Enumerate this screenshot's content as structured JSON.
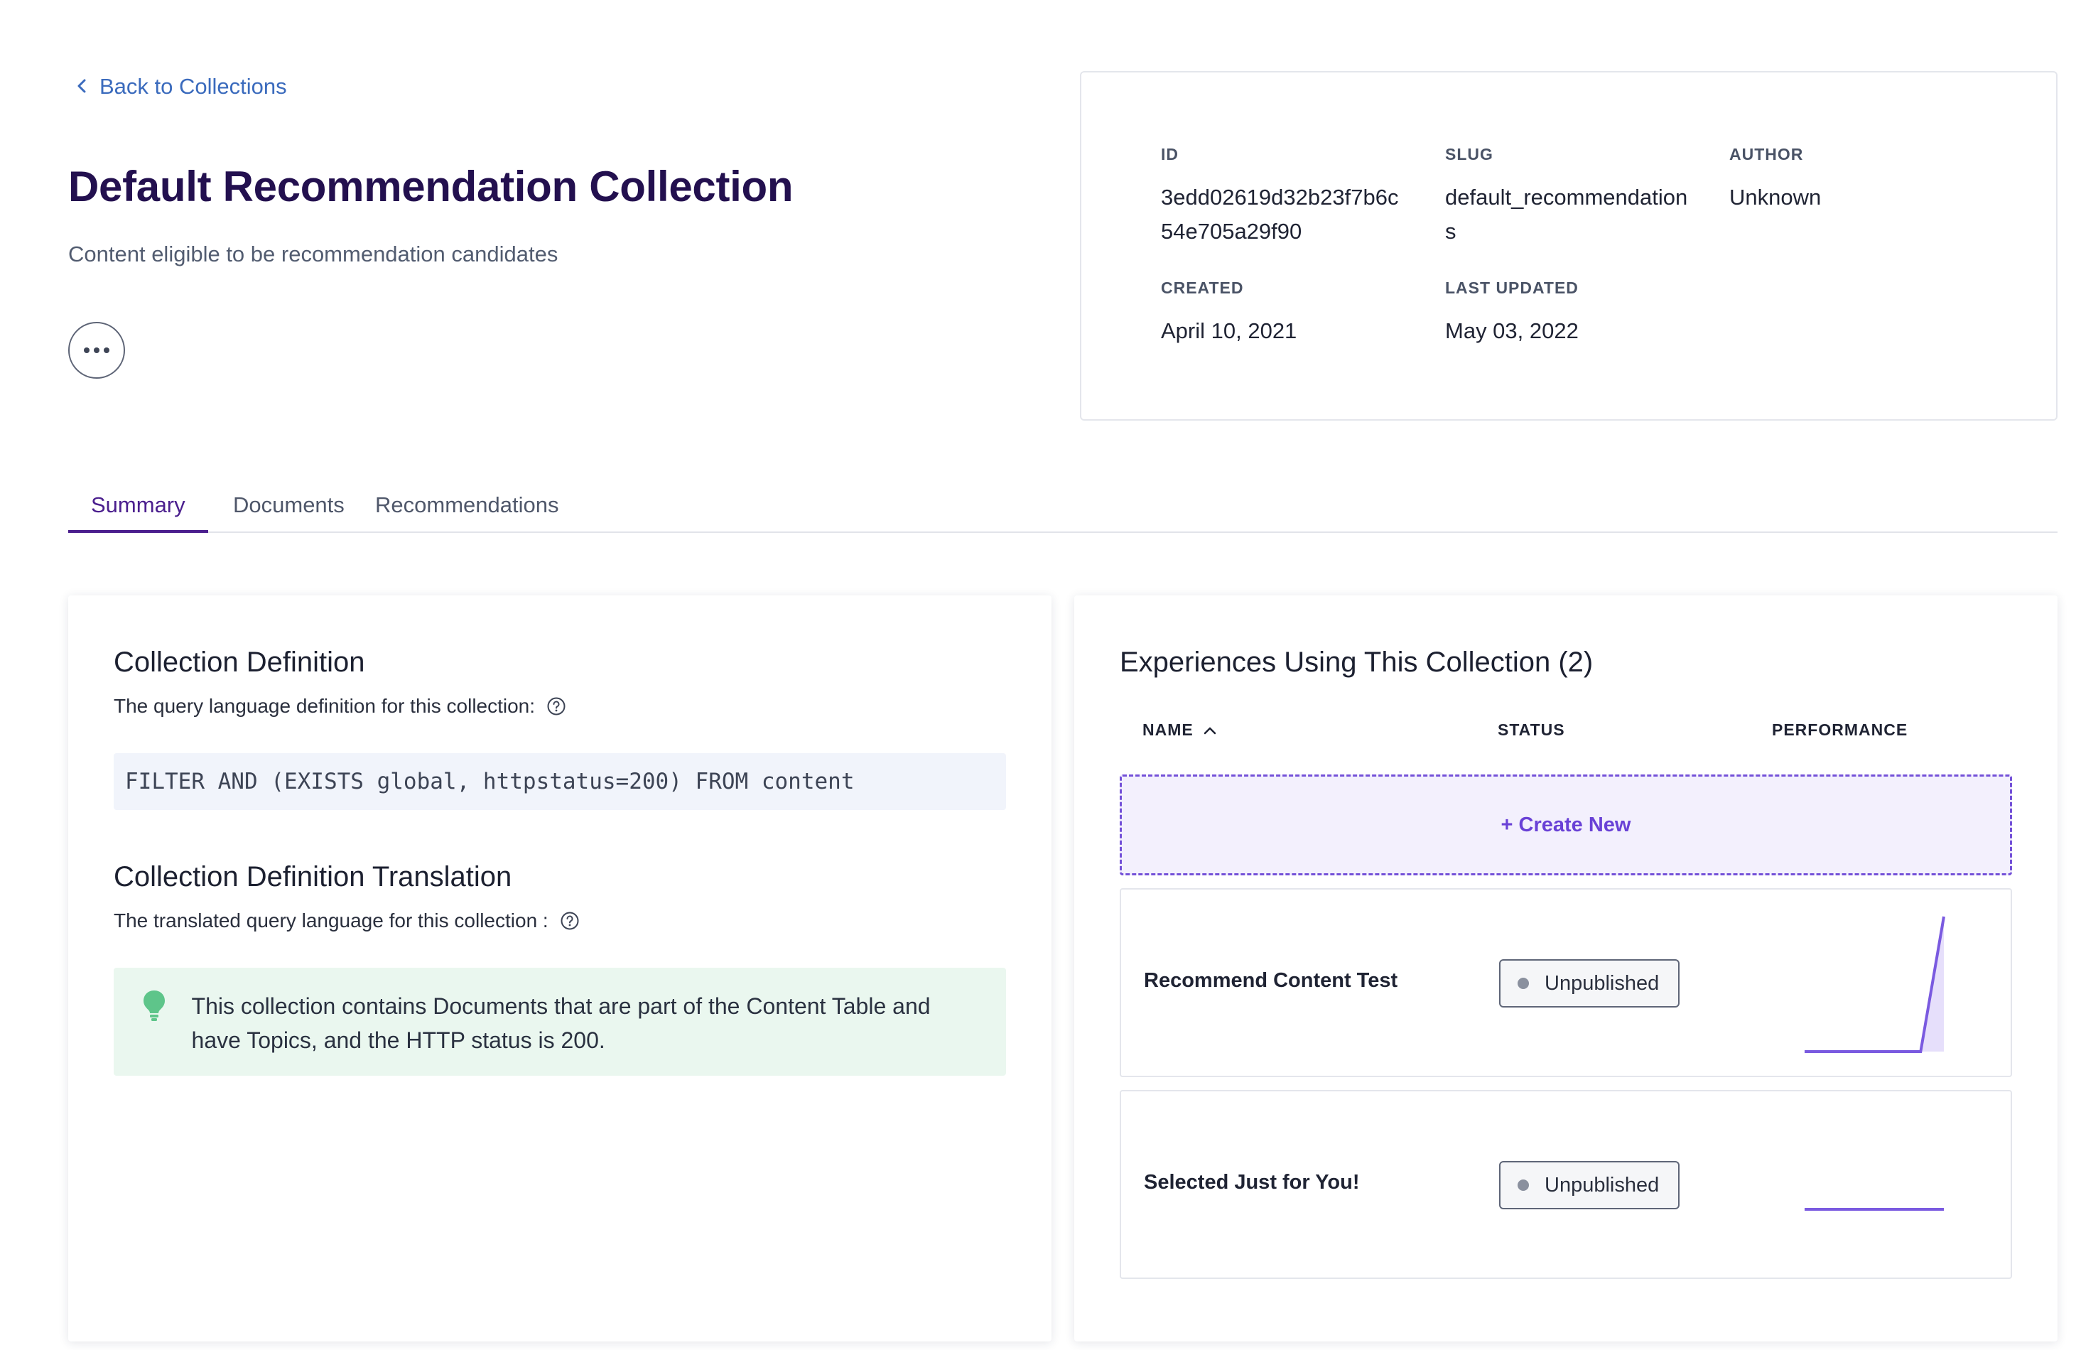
{
  "header": {
    "back_link": "Back to Collections",
    "title": "Default Recommendation Collection",
    "subtitle": "Content eligible to be recommendation candidates",
    "more_icon": "ellipsis-icon"
  },
  "meta": {
    "id_label": "ID",
    "id_value": "3edd02619d32b23f7b6c54e705a29f90",
    "slug_label": "SLUG",
    "slug_value": "default_recommendations",
    "author_label": "AUTHOR",
    "author_value": "Unknown",
    "created_label": "CREATED",
    "created_value": "April 10, 2021",
    "updated_label": "LAST UPDATED",
    "updated_value": "May 03, 2022"
  },
  "tabs": [
    {
      "label": "Summary",
      "active": true
    },
    {
      "label": "Documents",
      "active": false
    },
    {
      "label": "Recommendations",
      "active": false
    }
  ],
  "definition": {
    "title": "Collection Definition",
    "description": "The query language definition for this collection:",
    "query": "FILTER AND (EXISTS global, httpstatus=200) FROM content"
  },
  "translation": {
    "title": "Collection Definition Translation",
    "description": "The translated query language for this collection :",
    "text": "This collection contains Documents that are part of the Content Table and have Topics, and the HTTP status is 200."
  },
  "experiences": {
    "title": "Experiences Using This Collection (2)",
    "columns": {
      "name": "NAME",
      "status": "STATUS",
      "performance": "PERFORMANCE"
    },
    "create_new": "+ Create New",
    "rows": [
      {
        "name": "Recommend Content Test",
        "status": "Unpublished",
        "performance": [
          0,
          0,
          0,
          0,
          0,
          0,
          1
        ]
      },
      {
        "name": "Selected Just for You!",
        "status": "Unpublished",
        "performance": [
          0,
          0,
          0,
          0,
          0,
          0,
          0
        ]
      }
    ]
  },
  "colors": {
    "accent": "#4b1f8e",
    "link": "#3b6bbd",
    "create_new": "#6941d6",
    "spark_line": "#7a5ae0",
    "spark_fill": "#e6dffb",
    "callout_bg": "#eaf7ef",
    "bulb": "#5ec58a"
  }
}
